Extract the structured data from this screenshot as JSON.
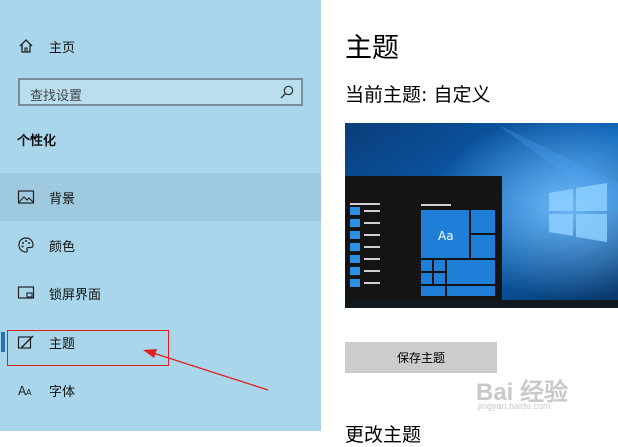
{
  "sidebar": {
    "home_label": "主页",
    "search_placeholder": "查找设置",
    "section_title": "个性化",
    "items": [
      {
        "label": "背景",
        "icon": "picture-icon"
      },
      {
        "label": "颜色",
        "icon": "palette-icon"
      },
      {
        "label": "锁屏界面",
        "icon": "lock-screen-icon"
      },
      {
        "label": "主题",
        "icon": "brush-icon"
      },
      {
        "label": "字体",
        "icon": "font-icon"
      }
    ]
  },
  "main": {
    "title": "主题",
    "current_theme_label": "当前主题: 自定义",
    "preview_tile_text": "Aa",
    "save_button_label": "保存主题",
    "next_heading_partial": "更改主题"
  },
  "watermark": {
    "text": "Bai 经验",
    "url": "jingyan.baidu.com"
  },
  "colors": {
    "sidebar_bg": "#a9d6ea",
    "selected_bg": "#9ec9de",
    "accent": "#2d6fb5",
    "annotation": "#e02020"
  }
}
